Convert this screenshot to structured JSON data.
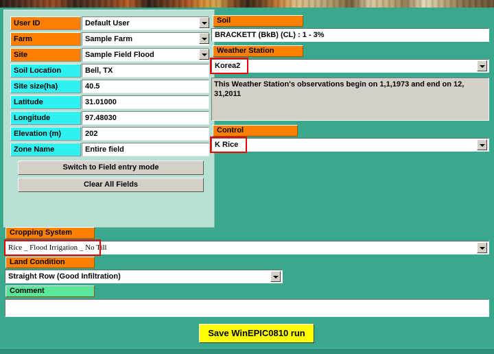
{
  "window": {
    "background_color": "#3aa88d",
    "panel_color": "#b6e0d3"
  },
  "left_panel": {
    "fields": [
      {
        "label": "User ID",
        "value": "Default User",
        "label_color": "orange",
        "dropdown": true
      },
      {
        "label": "Farm",
        "value": "Sample Farm",
        "label_color": "orange",
        "dropdown": true
      },
      {
        "label": "Site",
        "value": "Sample Field Flood",
        "label_color": "orange",
        "dropdown": true
      },
      {
        "label": "Soil Location",
        "value": "Bell, TX",
        "label_color": "cyan",
        "dropdown": false
      },
      {
        "label": "Site  size(ha)",
        "value": "40.5",
        "label_color": "cyan",
        "dropdown": false
      },
      {
        "label": "Latitude",
        "value": "31.01000",
        "label_color": "cyan",
        "dropdown": false
      },
      {
        "label": "Longitude",
        "value": "97.48030",
        "label_color": "cyan",
        "dropdown": false
      },
      {
        "label": "Elevation (m)",
        "value": "202",
        "label_color": "cyan",
        "dropdown": false
      },
      {
        "label": "Zone Name",
        "value": "Entire field",
        "label_color": "cyan",
        "dropdown": false
      }
    ],
    "switch_mode_button": "Switch to Field entry mode",
    "clear_fields_button": "Clear All Fields"
  },
  "right_panel": {
    "soil": {
      "tag": "Soil",
      "value": "BRACKETT (BkB) (CL) : 1 - 3%"
    },
    "weather_station": {
      "tag": "Weather Station",
      "value": "Korea2",
      "highlighted": true,
      "info_text": "This Weather Station's observations begin on 1,1,1973 and end on 12, 31,2011"
    },
    "control": {
      "tag": "Control",
      "value": "K Rice",
      "highlighted": true
    }
  },
  "bottom_panel": {
    "cropping_system": {
      "tag": "Cropping System",
      "value": "Rice _ Flood Irrigation _ No Till",
      "highlighted": true
    },
    "land_condition": {
      "tag": "Land Condition",
      "value": "Straight Row  (Good Infiltration)"
    },
    "comment": {
      "tag": "Comment",
      "value": "",
      "tag_color": "#5ce69a"
    },
    "save_button": "Save WinEPIC0810 run",
    "save_button_color": "#ffff00"
  },
  "annotation": {
    "highlight_color": "#ee0000"
  }
}
